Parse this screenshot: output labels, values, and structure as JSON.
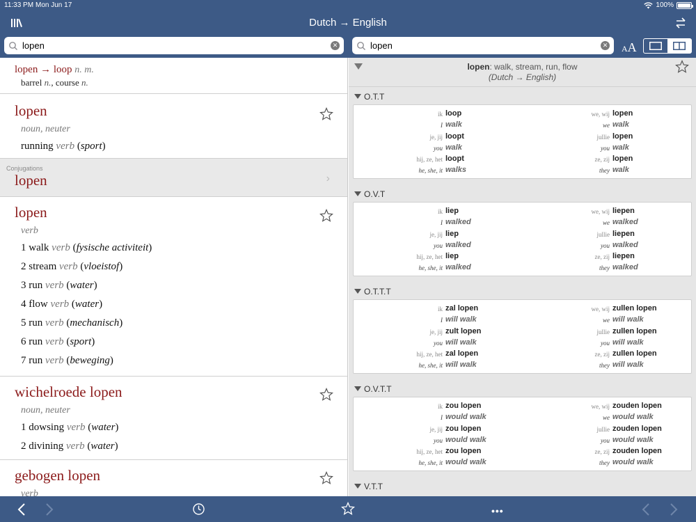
{
  "status": {
    "time": "11:33 PM",
    "date": "Mon Jun 17",
    "battery": "100%"
  },
  "header": {
    "title": "Dutch → English"
  },
  "search_left": {
    "value": "lopen"
  },
  "search_right": {
    "value": "lopen"
  },
  "font_size": {
    "small": "A",
    "big": "A"
  },
  "left": {
    "first": {
      "from": "lopen",
      "arrow": " → ",
      "to": "loop",
      "pos": "n. m.",
      "w1": "barrel ",
      "w1pos": "n.",
      "sep": ", ",
      "w2": "course ",
      "w2pos": "n."
    },
    "entry1": {
      "headword": "lopen",
      "pos": "noun, neuter",
      "sense": {
        "word": "running ",
        "pos": "verb",
        "ctx": "sport"
      }
    },
    "conj": {
      "label": "Conjugations",
      "headword": "lopen"
    },
    "entry2": {
      "headword": "lopen",
      "pos": "verb",
      "senses": [
        {
          "n": "1",
          "word": "walk",
          "pos": "verb",
          "ctx": "fysische activiteit"
        },
        {
          "n": "2",
          "word": "stream",
          "pos": "verb",
          "ctx": "vloeistof"
        },
        {
          "n": "3",
          "word": "run",
          "pos": "verb",
          "ctx": "water"
        },
        {
          "n": "4",
          "word": "flow",
          "pos": "verb",
          "ctx": "water"
        },
        {
          "n": "5",
          "word": "run",
          "pos": "verb",
          "ctx": "mechanisch"
        },
        {
          "n": "6",
          "word": "run",
          "pos": "verb",
          "ctx": "sport"
        },
        {
          "n": "7",
          "word": "run",
          "pos": "verb",
          "ctx": "beweging"
        }
      ]
    },
    "entry3": {
      "headword": "wichelroede lopen",
      "pos": "noun, neuter",
      "senses": [
        {
          "n": "1",
          "word": "dowsing",
          "pos": "verb",
          "ctx": "water"
        },
        {
          "n": "2",
          "word": "divining",
          "pos": "verb",
          "ctx": "water"
        }
      ]
    },
    "entry4": {
      "headword": "gebogen lopen",
      "pos": "verb"
    }
  },
  "right": {
    "summary_word": "lopen",
    "summary_rest": ": walk, stream, run, flow",
    "summary_dir": "(Dutch → English)",
    "tenses": [
      {
        "name": "O.T.T",
        "rows": [
          {
            "p1": "ik",
            "v1": "loop",
            "e1": "I",
            "t1": "walk",
            "p2": "we, wij",
            "v2": "lopen",
            "e2": "we",
            "t2": "walk"
          },
          {
            "p1": "je, jij",
            "v1": "loopt",
            "e1": "you",
            "t1": "walk",
            "p2": "jullie",
            "v2": "lopen",
            "e2": "you",
            "t2": "walk"
          },
          {
            "p1": "hij, ze, het",
            "v1": "loopt",
            "e1": "he, she, it",
            "t1": "walks",
            "p2": "ze, zij",
            "v2": "lopen",
            "e2": "they",
            "t2": "walk"
          }
        ]
      },
      {
        "name": "O.V.T",
        "rows": [
          {
            "p1": "ik",
            "v1": "liep",
            "e1": "I",
            "t1": "walked",
            "p2": "we, wij",
            "v2": "liepen",
            "e2": "we",
            "t2": "walked"
          },
          {
            "p1": "je, jij",
            "v1": "liep",
            "e1": "you",
            "t1": "walked",
            "p2": "jullie",
            "v2": "liepen",
            "e2": "you",
            "t2": "walked"
          },
          {
            "p1": "hij, ze, het",
            "v1": "liep",
            "e1": "he, she, it",
            "t1": "walked",
            "p2": "ze, zij",
            "v2": "liepen",
            "e2": "they",
            "t2": "walked"
          }
        ]
      },
      {
        "name": "O.T.T.T",
        "rows": [
          {
            "p1": "ik",
            "v1": "zal lopen",
            "e1": "I",
            "t1": "will walk",
            "p2": "we, wij",
            "v2": "zullen lopen",
            "e2": "we",
            "t2": "will walk"
          },
          {
            "p1": "je, jij",
            "v1": "zult lopen",
            "e1": "you",
            "t1": "will walk",
            "p2": "jullie",
            "v2": "zullen lopen",
            "e2": "you",
            "t2": "will walk"
          },
          {
            "p1": "hij, ze, het",
            "v1": "zal lopen",
            "e1": "he, she, it",
            "t1": "will walk",
            "p2": "ze, zij",
            "v2": "zullen lopen",
            "e2": "they",
            "t2": "will walk"
          }
        ]
      },
      {
        "name": "O.V.T.T",
        "rows": [
          {
            "p1": "ik",
            "v1": "zou lopen",
            "e1": "I",
            "t1": "would walk",
            "p2": "we, wij",
            "v2": "zouden lopen",
            "e2": "we",
            "t2": "would walk"
          },
          {
            "p1": "je, jij",
            "v1": "zou lopen",
            "e1": "you",
            "t1": "would walk",
            "p2": "jullie",
            "v2": "zouden lopen",
            "e2": "you",
            "t2": "would walk"
          },
          {
            "p1": "hij, ze, het",
            "v1": "zou lopen",
            "e1": "he, she, it",
            "t1": "would walk",
            "p2": "ze, zij",
            "v2": "zouden lopen",
            "e2": "they",
            "t2": "would walk"
          }
        ]
      },
      {
        "name": "V.T.T",
        "rows": []
      }
    ]
  },
  "bottom": {
    "more": "•••"
  },
  "colors": {
    "bar": "#3d5a86",
    "headword": "#8b1a1a"
  }
}
